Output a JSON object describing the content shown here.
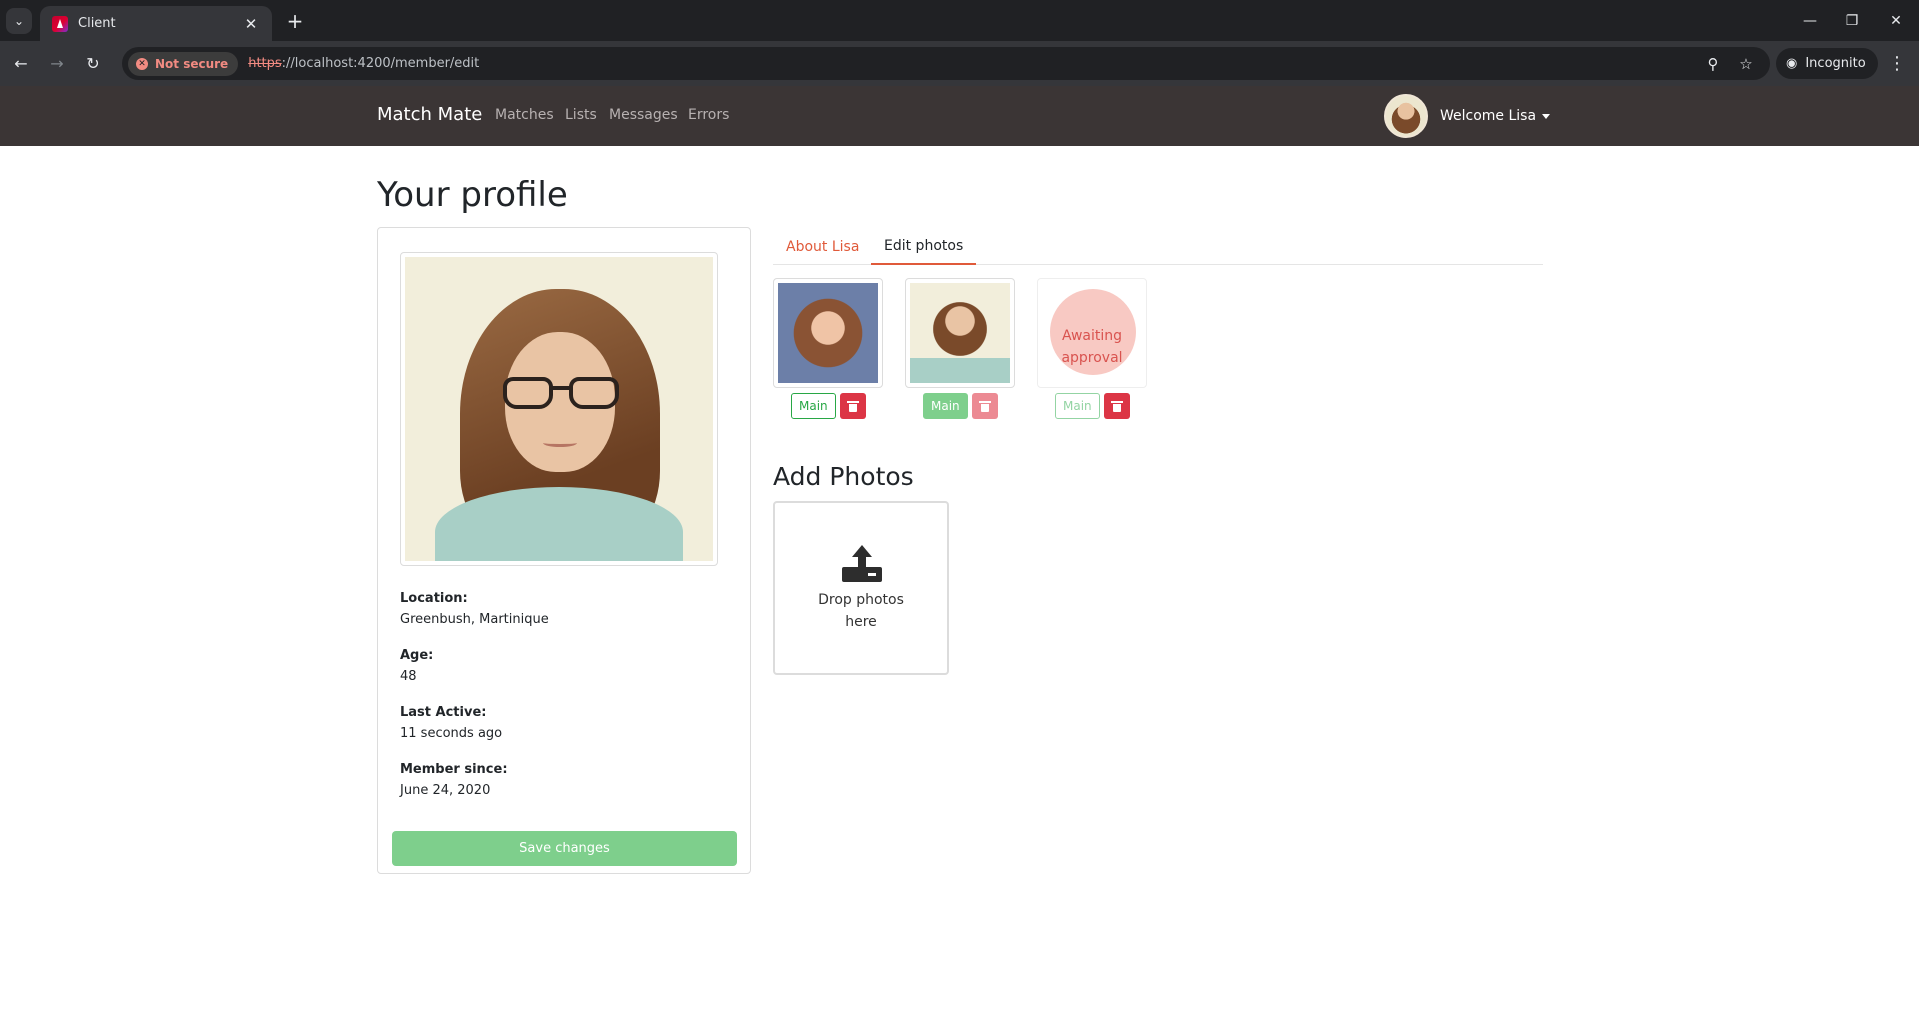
{
  "browser": {
    "tab_title": "Client",
    "not_secure": "Not secure",
    "url_scheme": "https",
    "url_rest": "://localhost:4200/member/edit",
    "incognito": "Incognito",
    "icons": {
      "tab_list": "chevron-down-icon",
      "close": "close-icon",
      "new_tab": "plus-icon",
      "back": "arrow-left-icon",
      "forward": "arrow-right-icon",
      "reload": "reload-icon",
      "zoom": "zoom-icon",
      "bookmark": "star-icon",
      "menu": "kebab-menu-icon"
    }
  },
  "navbar": {
    "brand": "Match Mate",
    "links": [
      "Matches",
      "Lists",
      "Messages",
      "Errors"
    ],
    "welcome": "Welcome Lisa"
  },
  "page": {
    "title": "Your profile"
  },
  "profile": {
    "location_label": "Location:",
    "location_value": "Greenbush, Martinique",
    "age_label": "Age:",
    "age_value": "48",
    "last_active_label": "Last Active:",
    "last_active_value": "11 seconds ago",
    "member_since_label": "Member since:",
    "member_since_value": "June 24, 2020",
    "save_button": "Save changes"
  },
  "tabs": [
    "About Lisa",
    "Edit photos"
  ],
  "photos": [
    {
      "main_label": "Main",
      "is_main": false,
      "approved": true
    },
    {
      "main_label": "Main",
      "is_main": true,
      "approved": true
    },
    {
      "main_label": "Main",
      "is_main": false,
      "approved": false,
      "pending_line1": "Awaiting",
      "pending_line2": "approval"
    }
  ],
  "add_photos": {
    "title": "Add Photos",
    "drop_line1": "Drop photos",
    "drop_line2": "here"
  },
  "colors": {
    "navbar": "#3b3535",
    "accent": "#e05a3a",
    "success": "#28a745",
    "danger": "#dc3545"
  }
}
